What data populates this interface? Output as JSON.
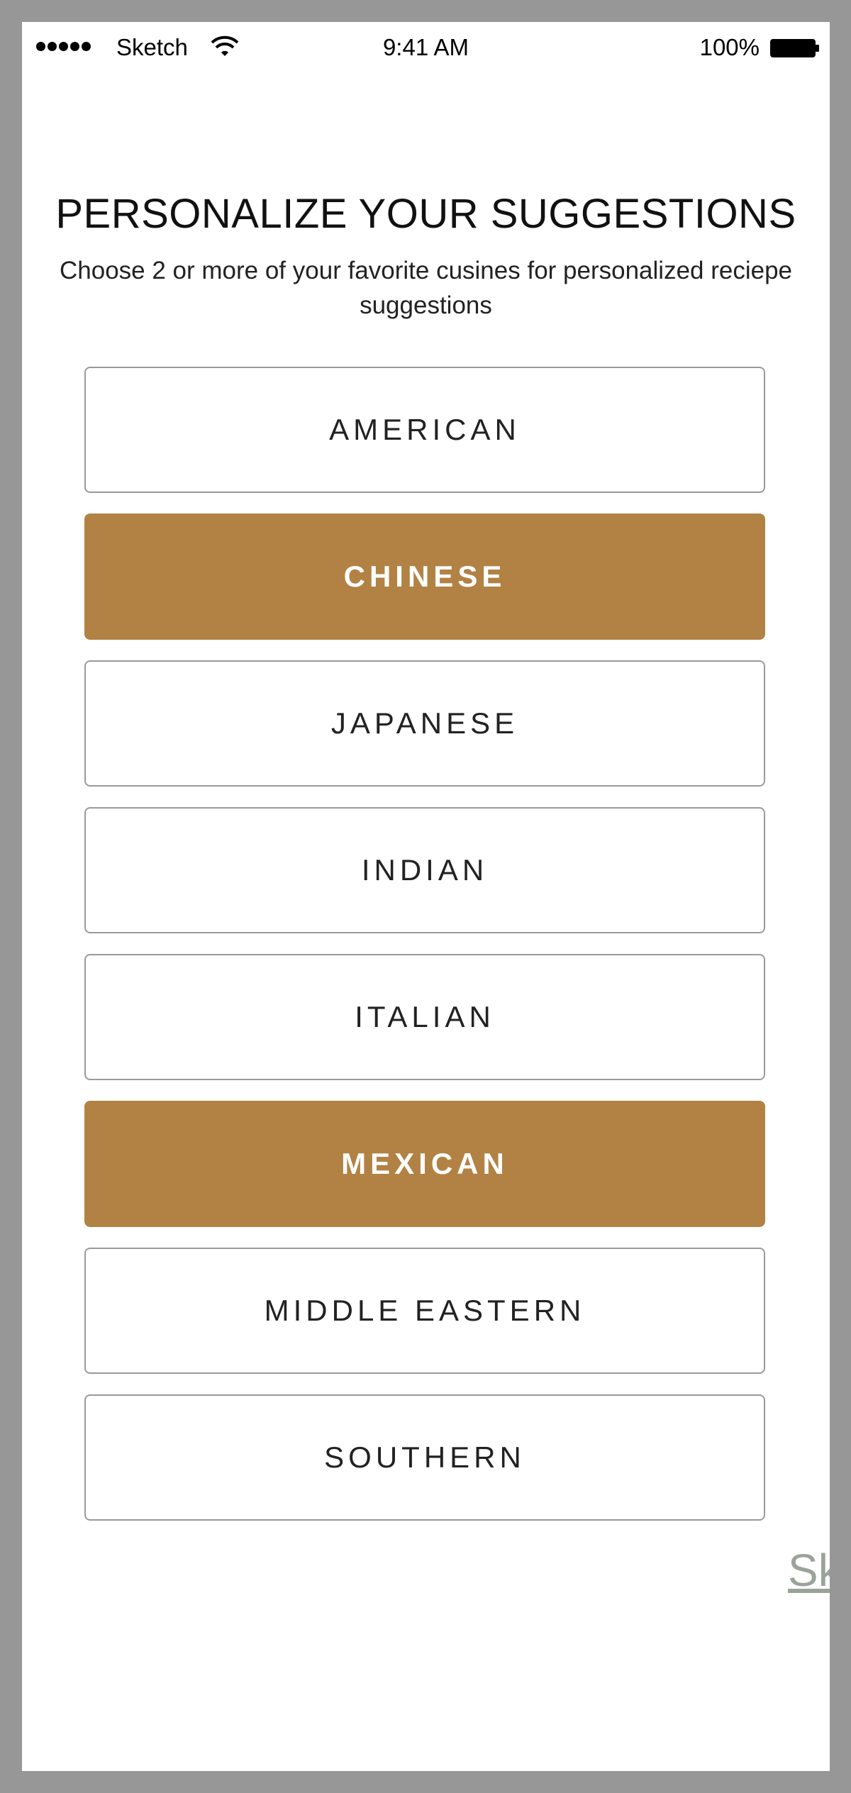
{
  "status_bar": {
    "carrier": "Sketch",
    "time": "9:41 AM",
    "battery": "100%",
    "signal_icon": "signal-dots-icon",
    "wifi_icon": "wifi-icon",
    "battery_icon": "battery-icon"
  },
  "header": {
    "title": "PERSONALIZE YOUR SUGGESTIONS",
    "subtitle": "Choose 2 or more of your favorite cusines for personalized reciepe suggestions"
  },
  "cuisines": [
    {
      "label": "AMERICAN",
      "selected": false
    },
    {
      "label": "CHINESE",
      "selected": true
    },
    {
      "label": "JAPANESE",
      "selected": false
    },
    {
      "label": "INDIAN",
      "selected": false
    },
    {
      "label": "ITALIAN",
      "selected": false
    },
    {
      "label": "MEXICAN",
      "selected": true
    },
    {
      "label": "MIDDLE EASTERN",
      "selected": false
    },
    {
      "label": "SOUTHERN",
      "selected": false
    }
  ],
  "skip_label": "Sk",
  "colors": {
    "selected_bg": "#b28244",
    "border": "#9a9a9a",
    "skip": "#9aa39a"
  }
}
